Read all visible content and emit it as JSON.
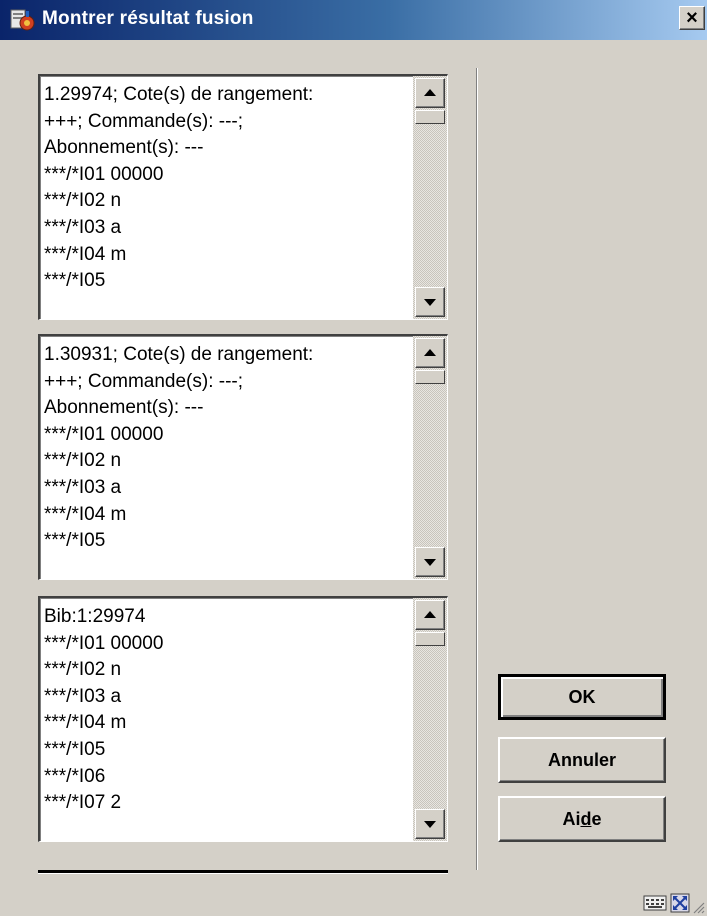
{
  "window": {
    "title": "Montrer résultat fusion",
    "close_label": "×"
  },
  "panes": [
    {
      "lines": [
        "1.29974; Cote(s) de rangement:",
        "+++; Commande(s): ---;",
        "Abonnement(s): ---",
        "***/*I01 00000",
        "***/*I02 n",
        "***/*I03 a",
        "***/*I04 m",
        "***/*I05"
      ]
    },
    {
      "lines": [
        "1.30931; Cote(s) de rangement:",
        "+++; Commande(s): ---;",
        "Abonnement(s): ---",
        "***/*I01 00000",
        "***/*I02 n",
        "***/*I03 a",
        "***/*I04 m",
        "***/*I05"
      ]
    },
    {
      "lines": [
        "Bib:1:29974",
        "***/*I01 00000",
        "***/*I02 n",
        "***/*I03 a",
        "***/*I04 m",
        "***/*I05",
        "***/*I06",
        "***/*I07 2"
      ]
    }
  ],
  "buttons": {
    "ok": "OK",
    "cancel": "Annuler",
    "help_prefix": "Ai",
    "help_underlined": "d",
    "help_suffix": "e"
  },
  "icons": {
    "app": "merge-app-icon",
    "close": "close-icon",
    "scroll_up": "scroll-up-arrow-icon",
    "scroll_down": "scroll-down-arrow-icon",
    "grid": "keyboard-grid-icon",
    "fullscreen": "fullscreen-icon",
    "resize": "resize-grip-icon"
  },
  "colors": {
    "titlebar_start": "#0a246a",
    "titlebar_end": "#a6caf0",
    "face": "#d4d0c8"
  }
}
